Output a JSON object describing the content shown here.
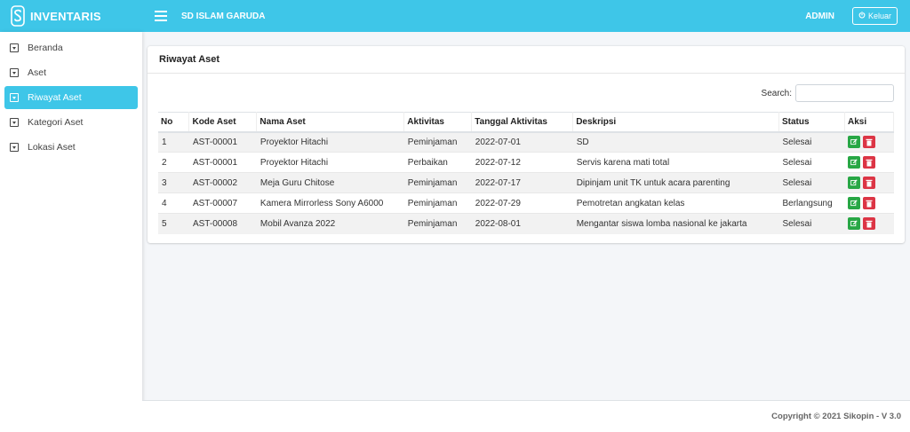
{
  "topbar": {
    "brand": "INVENTARIS",
    "school": "SD ISLAM GARUDA",
    "user": "ADMIN",
    "logout_label": "Keluar"
  },
  "sidebar": {
    "items": [
      {
        "label": "Beranda"
      },
      {
        "label": "Aset"
      },
      {
        "label": "Riwayat Aset"
      },
      {
        "label": "Kategori Aset"
      },
      {
        "label": "Lokasi Aset"
      }
    ],
    "active": "Riwayat Aset"
  },
  "card": {
    "title": "Riwayat Aset",
    "search_label": "Search:",
    "search_value": ""
  },
  "table": {
    "headers": [
      "No",
      "Kode Aset",
      "Nama Aset",
      "Aktivitas",
      "Tanggal Aktivitas",
      "Deskripsi",
      "Status",
      "Aksi"
    ],
    "rows": [
      {
        "no": "1",
        "kode": "AST-00001",
        "nama": "Proyektor Hitachi",
        "aktivitas": "Peminjaman",
        "tanggal": "2022-07-01",
        "deskripsi": "SD",
        "status": "Selesai"
      },
      {
        "no": "2",
        "kode": "AST-00001",
        "nama": "Proyektor Hitachi",
        "aktivitas": "Perbaikan",
        "tanggal": "2022-07-12",
        "deskripsi": "Servis karena mati total",
        "status": "Selesai"
      },
      {
        "no": "3",
        "kode": "AST-00002",
        "nama": "Meja Guru Chitose",
        "aktivitas": "Peminjaman",
        "tanggal": "2022-07-17",
        "deskripsi": "Dipinjam unit TK untuk acara parenting",
        "status": "Selesai"
      },
      {
        "no": "4",
        "kode": "AST-00007",
        "nama": "Kamera Mirrorless Sony A6000",
        "aktivitas": "Peminjaman",
        "tanggal": "2022-07-29",
        "deskripsi": "Pemotretan angkatan kelas",
        "status": "Berlangsung"
      },
      {
        "no": "5",
        "kode": "AST-00008",
        "nama": "Mobil Avanza 2022",
        "aktivitas": "Peminjaman",
        "tanggal": "2022-08-01",
        "deskripsi": "Mengantar siswa lomba nasional ke jakarta",
        "status": "Selesai"
      }
    ]
  },
  "footer": {
    "text": "Copyright © 2021 Sikopin - V 3.0"
  },
  "colors": {
    "accent": "#3ec6e8",
    "edit": "#28a745",
    "delete": "#dc3545"
  }
}
